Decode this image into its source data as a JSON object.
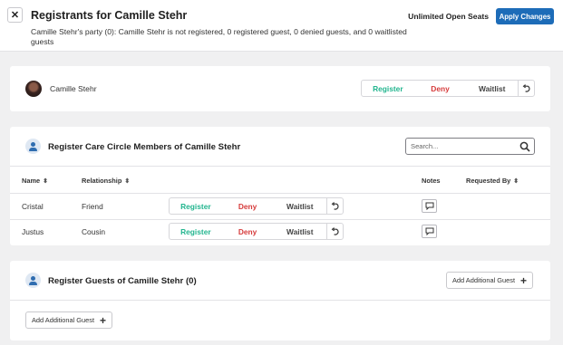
{
  "header": {
    "close_label": "✕",
    "title": "Registrants for Camille Stehr",
    "subtitle": "Camille Stehr's party (0): Camille Stehr is not registered, 0 registered guest, 0 denied guests, and 0 waitlisted guests",
    "open_seats": "Unlimited Open Seats",
    "apply_label": "Apply Changes"
  },
  "member": {
    "name": "Camille Stehr",
    "actions": {
      "register": "Register",
      "deny": "Deny",
      "waitlist": "Waitlist"
    }
  },
  "care_circle": {
    "title": "Register Care Circle Members of Camille Stehr",
    "search_placeholder": "Search...",
    "columns": {
      "name": "Name",
      "relationship": "Relationship",
      "notes": "Notes",
      "requested_by": "Requested By"
    },
    "rows": [
      {
        "name": "Cristal",
        "relationship": "Friend",
        "register": "Register",
        "deny": "Deny",
        "waitlist": "Waitlist"
      },
      {
        "name": "Justus",
        "relationship": "Cousin",
        "register": "Register",
        "deny": "Deny",
        "waitlist": "Waitlist"
      }
    ]
  },
  "guests": {
    "title": "Register Guests of Camille Stehr (0)",
    "add_label_top": "Add Additional Guest",
    "add_label_bottom": "Add Additional Guest"
  },
  "colors": {
    "primary": "#1d6cb8",
    "register": "#23b58f",
    "deny": "#d63b3b"
  }
}
